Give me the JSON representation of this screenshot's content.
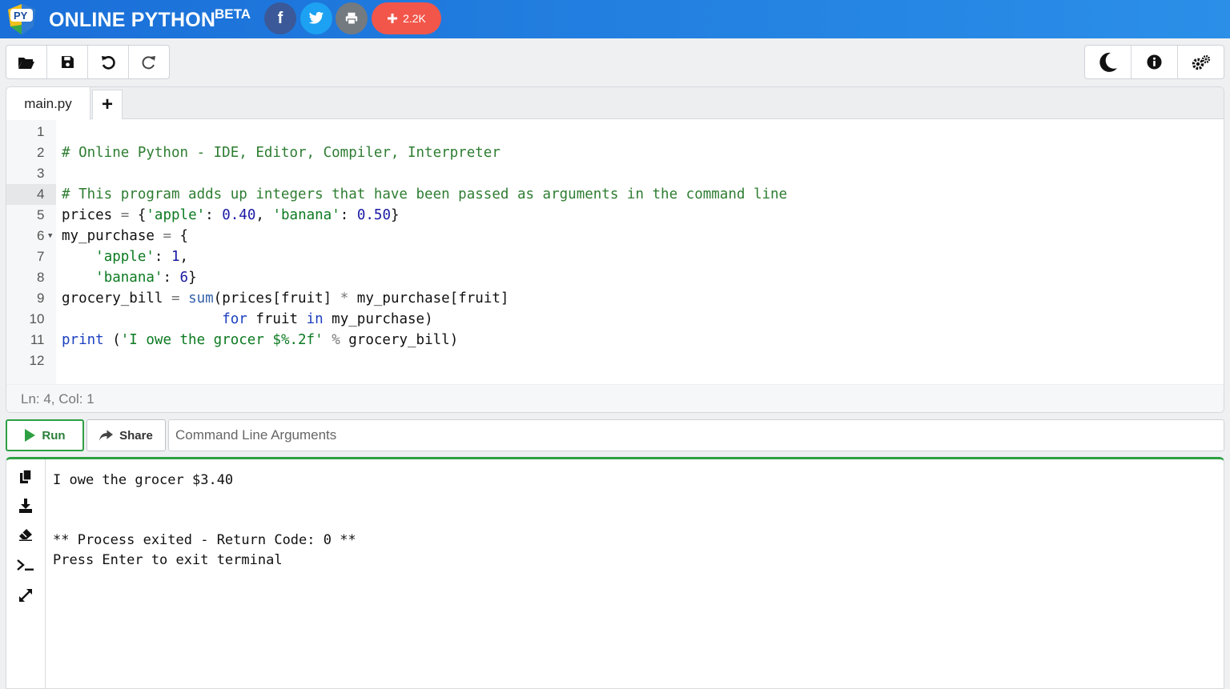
{
  "header": {
    "logo_text": "PY",
    "brand": "ONLINE PYTHON",
    "beta": "BETA",
    "facebook_glyph": "f",
    "share_count": "2.2K"
  },
  "toolbar": {
    "left": [
      "open-folder-icon",
      "save-icon",
      "undo-icon",
      "redo-icon"
    ],
    "right": [
      "moon-icon",
      "info-icon",
      "settings-icon"
    ]
  },
  "editor": {
    "tab_label": "main.py",
    "add_tab": "+",
    "lines": [
      {
        "n": "1"
      },
      {
        "n": "2"
      },
      {
        "n": "3"
      },
      {
        "n": "4"
      },
      {
        "n": "5"
      },
      {
        "n": "6"
      },
      {
        "n": "7"
      },
      {
        "n": "8"
      },
      {
        "n": "9"
      },
      {
        "n": "10"
      },
      {
        "n": "11"
      },
      {
        "n": "12"
      }
    ],
    "code": {
      "l2": "# Online Python - IDE, Editor, Compiler, Interpreter",
      "l4": "# This program adds up integers that have been passed as arguments in the command line",
      "l5_a": "prices ",
      "l5_b": "=",
      "l5_c": " {",
      "l5_d": "'apple'",
      "l5_e": ": ",
      "l5_f": "0.40",
      "l5_g": ", ",
      "l5_h": "'banana'",
      "l5_i": ": ",
      "l5_j": "0.50",
      "l5_k": "}",
      "l6_a": "my_purchase ",
      "l6_b": "=",
      "l6_c": " {",
      "l7_a": "    ",
      "l7_b": "'apple'",
      "l7_c": ": ",
      "l7_d": "1",
      "l7_e": ",",
      "l8_a": "    ",
      "l8_b": "'banana'",
      "l8_c": ": ",
      "l8_d": "6",
      "l8_e": "}",
      "l9_a": "grocery_bill ",
      "l9_b": "=",
      "l9_c": " ",
      "l9_d": "sum",
      "l9_e": "(prices[fruit] ",
      "l9_f": "*",
      "l9_g": " my_purchase[fruit]",
      "l10_a": "                   ",
      "l10_b": "for",
      "l10_c": " fruit ",
      "l10_d": "in",
      "l10_e": " my_purchase)",
      "l11_a": "print",
      "l11_b": " (",
      "l11_c": "'I owe the grocer $%.2f'",
      "l11_d": " ",
      "l11_e": "%",
      "l11_f": " grocery_bill)"
    },
    "status": "Ln: 4,  Col: 1"
  },
  "runbar": {
    "run_label": "Run",
    "share_label": "Share",
    "args_placeholder": "Command Line Arguments"
  },
  "terminal": {
    "output": "I owe the grocer $3.40\n\n\n** Process exited - Return Code: 0 **\nPress Enter to exit terminal",
    "side_icons": [
      "copy-icon",
      "download-icon",
      "eraser-icon",
      "terminal-icon",
      "expand-icon"
    ]
  }
}
